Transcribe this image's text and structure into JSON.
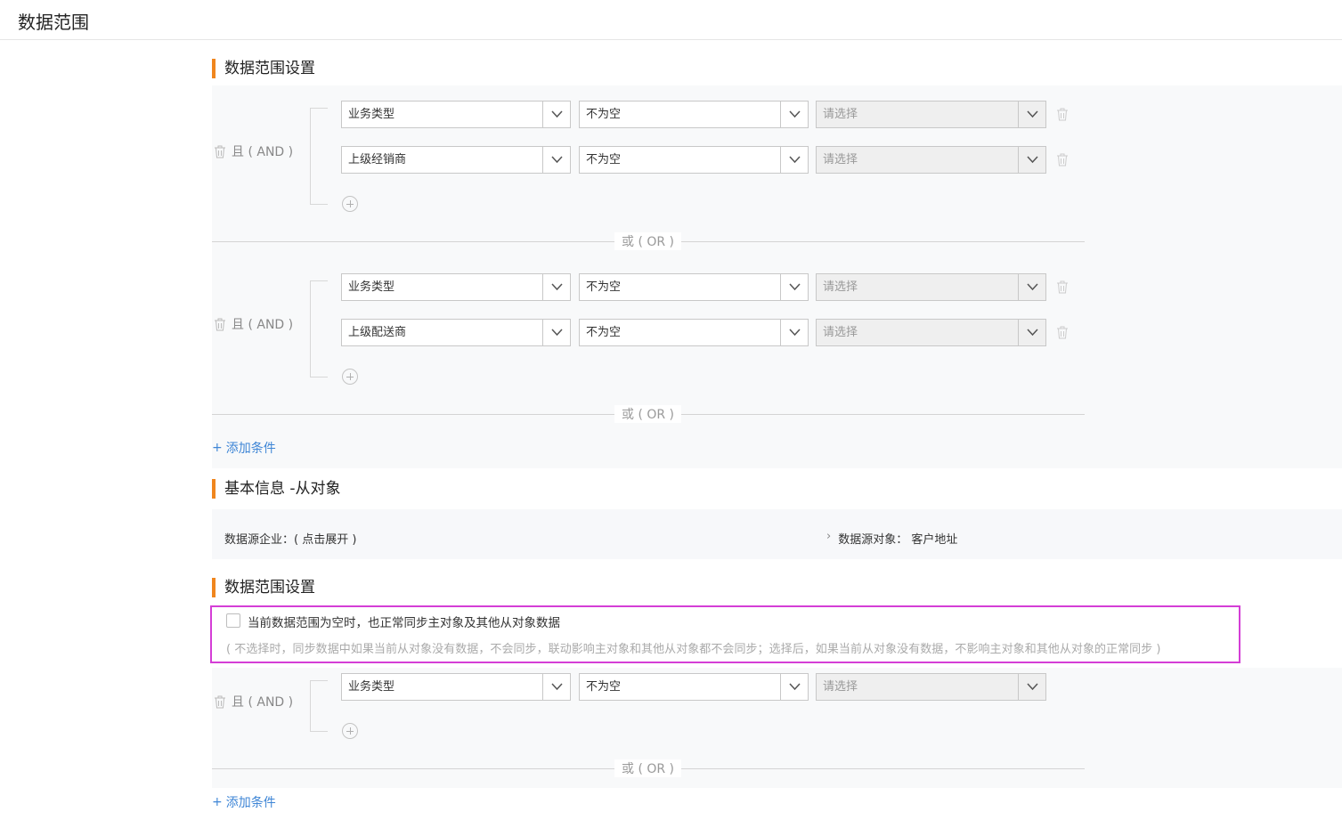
{
  "page": {
    "title": "数据范围"
  },
  "sections": {
    "scope1_title": "数据范围设置",
    "basic_title": "基本信息 -从对象",
    "scope2_title": "数据范围设置"
  },
  "common": {
    "and_label": "且 ( AND )",
    "or_label": "或 ( OR )",
    "add_condition": "添加条件",
    "placeholder": "请选择"
  },
  "scope1": {
    "group1": [
      {
        "field": "业务类型",
        "operator": "不为空",
        "value": "请选择"
      },
      {
        "field": "上级经销商",
        "operator": "不为空",
        "value": "请选择"
      }
    ],
    "group2": [
      {
        "field": "业务类型",
        "operator": "不为空",
        "value": "请选择"
      },
      {
        "field": "上级配送商",
        "operator": "不为空",
        "value": "请选择"
      }
    ]
  },
  "basic_info": {
    "source_company_label": "数据源企业：",
    "source_company_value": "( 点击展开 )",
    "source_object_label": "数据源对象：",
    "source_object_value": "客户地址"
  },
  "scope2": {
    "checkbox_label": "当前数据范围为空时，也正常同步主对象及其他从对象数据",
    "note": "( 不选择时，同步数据中如果当前从对象没有数据，不会同步，联动影响主对象和其他从对象都不会同步；选择后，如果当前从对象没有数据，不影响主对象和其他从对象的正常同步 )",
    "group1": [
      {
        "field": "业务类型",
        "operator": "不为空",
        "value": "请选择"
      }
    ]
  },
  "colors": {
    "accent": "#f0861e",
    "link": "#3f86d6",
    "highlight": "#d43ed6"
  }
}
